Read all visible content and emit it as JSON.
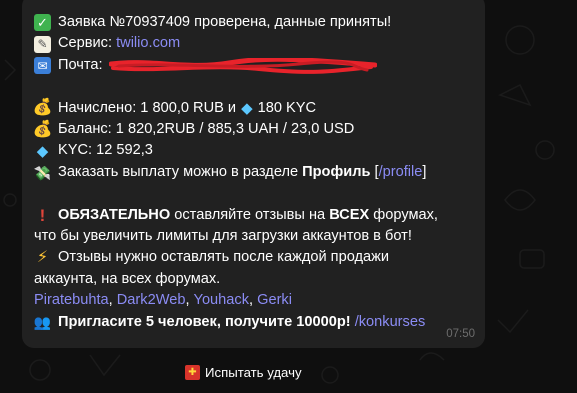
{
  "message": {
    "line1": "Заявка №70937409 проверена, данные приняты!",
    "service_label": "Сервис:",
    "service_value": "twilio.com",
    "mail_label": "Почта:",
    "accrued": "Начислено: 1 800,0 RUB и",
    "accrued_kyc": "180 KYC",
    "balance": "Баланс: 1 820,2RUB  / 885,3 UAH / 23,0 USD",
    "kyc": "KYC: 12 592,3",
    "payout_prefix": "Заказать выплату можно в разделе",
    "payout_bold": "Профиль",
    "payout_open": "[",
    "payout_link": "/profile",
    "payout_close": "]",
    "must_bold": "ОБЯЗАТЕЛЬНО",
    "must_rest_a": "оставляйте отзывы на",
    "must_all": "ВСЕХ",
    "must_rest_b": "форумах,",
    "must_line2": "что бы увеличить лимиты для загрузки аккаунтов в бот!",
    "reviews_line1": "Отзывы нужно оставлять после каждой продажи",
    "reviews_line2": "аккаунта, на всех форумах.",
    "forums": [
      "Piratebuhta",
      "Dark2Web",
      "Youhack",
      "Gerki"
    ],
    "invite_bold": "Пригласите 5 человек, получите 10000р!",
    "invite_link": "/konkurses",
    "time": "07:50"
  },
  "inline_button": {
    "label": "Испытать удачу"
  },
  "colors": {
    "link": "#8b8cf4",
    "bubble": "#212121",
    "background": "#0f0f0f",
    "redaction": "#e8232b"
  },
  "icons": [
    "check-mark-icon",
    "memo-icon",
    "envelope-icon",
    "money-bag-icon",
    "gem-icon",
    "money-with-wings-icon",
    "exclamation-icon",
    "lightning-icon",
    "people-icon",
    "gift-icon"
  ]
}
